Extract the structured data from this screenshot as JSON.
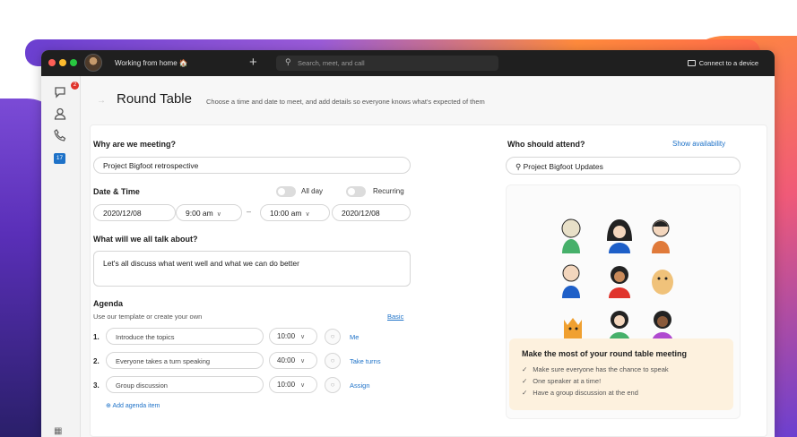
{
  "window": {
    "status": "Working from home 🏠",
    "search_placeholder": "Search, meet, and call",
    "connect_label": "Connect to a device"
  },
  "sidebar": {
    "notification_count": "2",
    "calendar_day": "17"
  },
  "header": {
    "title": "Round Table",
    "description": "Choose a time and date to meet, and add details so everyone knows what's expected of them"
  },
  "form": {
    "why_label": "Why are we meeting?",
    "why_value": "Project Bigfoot retrospective",
    "datetime_label": "Date & Time",
    "allday_label": "All day",
    "recurring_label": "Recurring",
    "start_date": "2020/12/08",
    "start_time": "9:00 am",
    "end_time": "10:00 am",
    "end_date": "2020/12/08",
    "talk_label": "What will we all talk about?",
    "talk_value": "Let's all discuss what went well and what we can do better",
    "agenda_label": "Agenda",
    "agenda_sub": "Use our template or create your own",
    "basic_link": "Basic",
    "agenda_items": [
      {
        "num": "1.",
        "topic": "Introduce the topics",
        "time": "10:00",
        "assignee": "Me"
      },
      {
        "num": "2.",
        "topic": "Everyone takes a turn speaking",
        "time": "40:00",
        "assignee": "Take turns"
      },
      {
        "num": "3.",
        "topic": "Group discussion",
        "time": "10:00",
        "assignee": "Assign"
      }
    ],
    "add_item": "Add agenda item"
  },
  "attendees": {
    "label": "Who should attend?",
    "show_availability": "Show availability",
    "search_value": "Project Bigfoot Updates"
  },
  "tip": {
    "title": "Make the most of your round table meeting",
    "items": [
      "Make sure everyone has the chance to speak",
      "One speaker at a time!",
      "Have a group discussion at the end"
    ]
  },
  "colors": {
    "accent": "#1e72c8",
    "tip_bg": "#fdf1de",
    "titlebar": "#1f1f1f"
  }
}
